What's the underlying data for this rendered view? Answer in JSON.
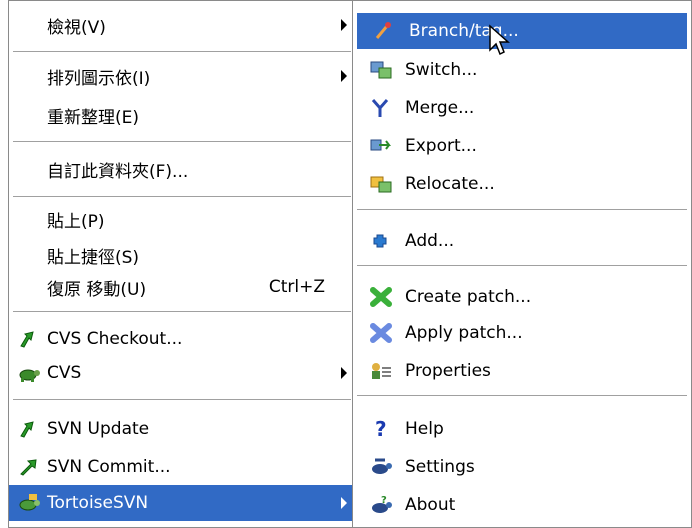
{
  "left_menu": {
    "view": {
      "label": "檢視(V)"
    },
    "arrange": {
      "label": "排列圖示依(I)"
    },
    "refresh": {
      "label": "重新整理(E)"
    },
    "customize": {
      "label": "自訂此資料夾(F)..."
    },
    "paste": {
      "label": "貼上(P)"
    },
    "paste_shortcut": {
      "label": "貼上捷徑(S)"
    },
    "undo": {
      "label": "復原 移動(U)",
      "shortcut": "Ctrl+Z"
    },
    "cvs_checkout": {
      "label": "CVS Checkout..."
    },
    "cvs": {
      "label": "CVS"
    },
    "svn_update": {
      "label": "SVN Update"
    },
    "svn_commit": {
      "label": "SVN Commit..."
    },
    "tortoisesvn": {
      "label": "TortoiseSVN"
    }
  },
  "right_menu": {
    "branch_tag": {
      "label": "Branch/tag..."
    },
    "switch": {
      "label": "Switch..."
    },
    "merge": {
      "label": "Merge..."
    },
    "export": {
      "label": "Export..."
    },
    "relocate": {
      "label": "Relocate..."
    },
    "add": {
      "label": "Add..."
    },
    "create_patch": {
      "label": "Create patch..."
    },
    "apply_patch": {
      "label": "Apply patch..."
    },
    "properties": {
      "label": "Properties"
    },
    "help": {
      "label": "Help"
    },
    "settings": {
      "label": "Settings"
    },
    "about": {
      "label": "About"
    }
  },
  "colors": {
    "highlight": "#316ac5",
    "menu_bg": "#ffffff"
  }
}
